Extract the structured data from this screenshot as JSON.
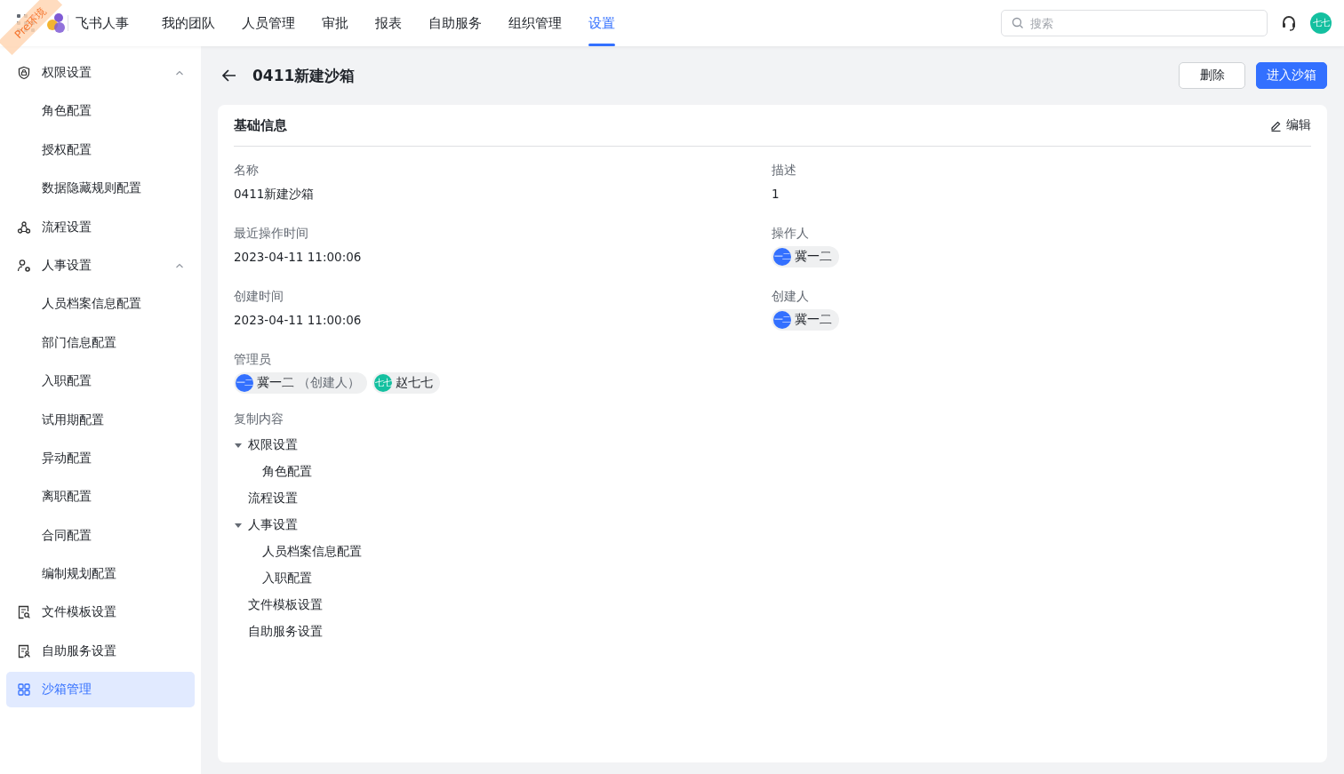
{
  "env_ribbon": "Pre环境",
  "app_name": "飞书人事",
  "nav": [
    {
      "label": "我的团队",
      "selected": false
    },
    {
      "label": "人员管理",
      "selected": false
    },
    {
      "label": "审批",
      "selected": false
    },
    {
      "label": "报表",
      "selected": false
    },
    {
      "label": "自助服务",
      "selected": false
    },
    {
      "label": "组织管理",
      "selected": false
    },
    {
      "label": "设置",
      "selected": true
    }
  ],
  "search": {
    "placeholder": "搜索"
  },
  "user_avatar": {
    "text": "七七",
    "color": "#14c0a0"
  },
  "sidebar": [
    {
      "label": "权限设置",
      "expanded": true,
      "selected": false,
      "children": [
        {
          "label": "角色配置",
          "selected": false
        },
        {
          "label": "授权配置",
          "selected": false
        },
        {
          "label": "数据隐藏规则配置",
          "selected": false
        }
      ]
    },
    {
      "label": "流程设置",
      "selected": false
    },
    {
      "label": "人事设置",
      "expanded": true,
      "selected": false,
      "children": [
        {
          "label": "人员档案信息配置",
          "selected": false
        },
        {
          "label": "部门信息配置",
          "selected": false
        },
        {
          "label": "入职配置",
          "selected": false
        },
        {
          "label": "试用期配置",
          "selected": false
        },
        {
          "label": "异动配置",
          "selected": false
        },
        {
          "label": "离职配置",
          "selected": false
        },
        {
          "label": "合同配置",
          "selected": false
        },
        {
          "label": "编制规划配置",
          "selected": false
        }
      ]
    },
    {
      "label": "文件模板设置",
      "selected": false
    },
    {
      "label": "自助服务设置",
      "selected": false
    },
    {
      "label": "沙箱管理",
      "selected": true
    }
  ],
  "page_title": "0411新建沙箱",
  "buttons": [
    {
      "label": "删除",
      "kind": "default"
    },
    {
      "label": "进入沙箱",
      "kind": "primary"
    }
  ],
  "section": {
    "title": "基础信息",
    "edit": "编辑"
  },
  "fields": [
    {
      "label": "名称",
      "kind": "text",
      "value": "0411新建沙箱"
    },
    {
      "label": "描述",
      "kind": "text",
      "value": "1"
    },
    {
      "label": "最近操作时间",
      "kind": "text",
      "value": "2023-04-11 11:00:06"
    },
    {
      "label": "操作人",
      "kind": "users",
      "users": [
        {
          "avatar": "一二",
          "name": "冀一二",
          "color": "#3370ff"
        }
      ]
    },
    {
      "label": "创建时间",
      "kind": "text",
      "value": "2023-04-11 11:00:06"
    },
    {
      "label": "创建人",
      "kind": "users",
      "users": [
        {
          "avatar": "一二",
          "name": "冀一二",
          "color": "#3370ff"
        }
      ]
    },
    {
      "label": "管理员",
      "kind": "users",
      "users": [
        {
          "avatar": "一二",
          "name": "冀一二",
          "note": "（创建人）",
          "color": "#3370ff"
        },
        {
          "avatar": "七七",
          "name": "赵七七",
          "color": "#14c0a0"
        }
      ]
    }
  ],
  "copy_content": {
    "label": "复制内容",
    "tree": [
      {
        "label": "权限设置",
        "expanded": true,
        "children": [
          {
            "label": "角色配置"
          }
        ]
      },
      {
        "label": "流程设置"
      },
      {
        "label": "人事设置",
        "expanded": true,
        "children": [
          {
            "label": "人员档案信息配置"
          },
          {
            "label": "入职配置"
          }
        ]
      },
      {
        "label": "文件模板设置"
      },
      {
        "label": "自助服务设置"
      }
    ]
  }
}
